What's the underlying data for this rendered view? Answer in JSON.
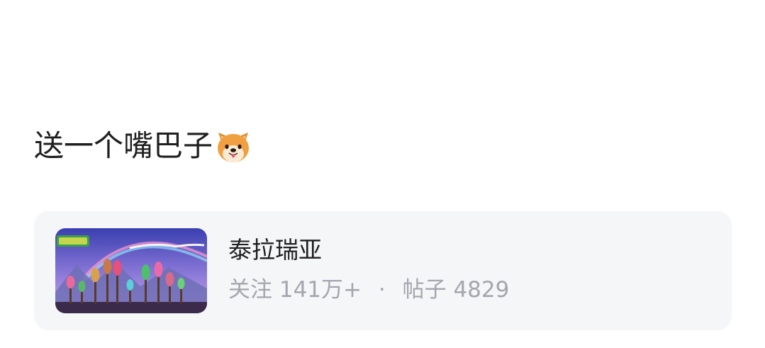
{
  "post": {
    "text": "送一个嘴巴子"
  },
  "forum_card": {
    "name": "泰拉瑞亚",
    "followers_label": "关注",
    "followers_value": "141万+",
    "separator": "·",
    "posts_label": "帖子",
    "posts_value": "4829"
  },
  "icons": {
    "emoji": "shiba-dog-face-emoji",
    "thumbnail": "terraria-game-thumbnail"
  }
}
